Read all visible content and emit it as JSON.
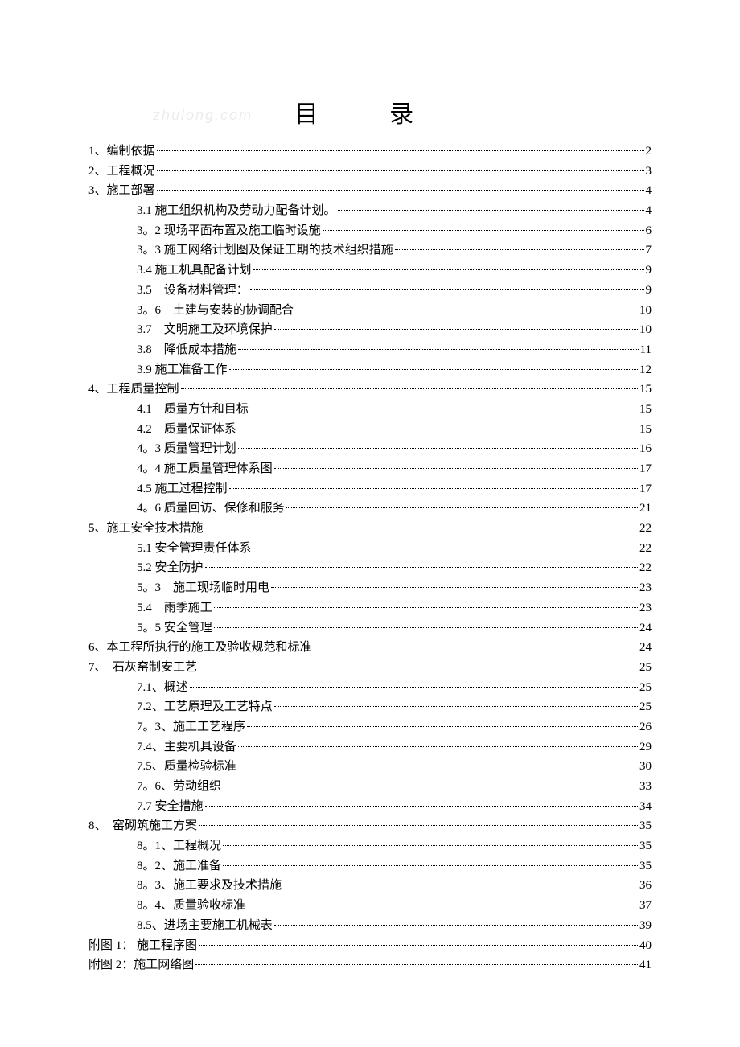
{
  "title": "目   录",
  "watermark": "zhulong.com",
  "toc": [
    {
      "label": "1、编制依据",
      "page": "2",
      "indent": false
    },
    {
      "label": "2、工程概况",
      "page": "3",
      "indent": false
    },
    {
      "label": "3、施工部署",
      "page": "4",
      "indent": false
    },
    {
      "label": "3.1  施工组织机构及劳动力配备计划。",
      "page": "4",
      "indent": true
    },
    {
      "label": "3。2  现场平面布置及施工临时设施",
      "page": "6",
      "indent": true
    },
    {
      "label": "3。3  施工网络计划图及保证工期的技术组织措施",
      "page": "7",
      "indent": true
    },
    {
      "label": "3.4 施工机具配备计划",
      "page": "9",
      "indent": true
    },
    {
      "label": "3.5　设备材料管理：",
      "page": "9",
      "indent": true
    },
    {
      "label": "3。6　土建与安装的协调配合",
      "page": "10",
      "indent": true
    },
    {
      "label": "3.7　文明施工及环境保护",
      "page": "10",
      "indent": true
    },
    {
      "label": "3.8　降低成本措施",
      "page": "11",
      "indent": true
    },
    {
      "label": "3.9  施工准备工作",
      "page": "12",
      "indent": true
    },
    {
      "label": "4、工程质量控制",
      "page": "15",
      "indent": false
    },
    {
      "label": "4.1　质量方针和目标",
      "page": "15",
      "indent": true
    },
    {
      "label": "4.2　质量保证体系",
      "page": "15",
      "indent": true
    },
    {
      "label": "4。3 质量管理计划",
      "page": "16",
      "indent": true
    },
    {
      "label": "4。4 施工质量管理体系图",
      "page": "17",
      "indent": true
    },
    {
      "label": "4.5 施工过程控制",
      "page": "17",
      "indent": true
    },
    {
      "label": "4。6  质量回访、保修和服务",
      "page": "21",
      "indent": true
    },
    {
      "label": "5、施工安全技术措施",
      "page": "22",
      "indent": false
    },
    {
      "label": "5.1  安全管理责任体系",
      "page": "22",
      "indent": true
    },
    {
      "label": "5.2 安全防护",
      "page": "22",
      "indent": true
    },
    {
      "label": "5。3　施工现场临时用电",
      "page": "23",
      "indent": true
    },
    {
      "label": "5.4　雨季施工",
      "page": "23",
      "indent": true
    },
    {
      "label": "5。5 安全管理",
      "page": "24",
      "indent": true
    },
    {
      "label": "6、本工程所执行的施工及验收规范和标准",
      "page": "24",
      "indent": false
    },
    {
      "label": "7、　石灰窑制安工艺",
      "page": "25",
      "indent": false
    },
    {
      "label": "7.1、概述",
      "page": "25",
      "indent": true
    },
    {
      "label": "7.2、工艺原理及工艺特点",
      "page": "25",
      "indent": true
    },
    {
      "label": "7。3、施工工艺程序",
      "page": "26",
      "indent": true
    },
    {
      "label": "7.4、主要机具设备",
      "page": "29",
      "indent": true
    },
    {
      "label": "7.5、质量检验标准",
      "page": "30",
      "indent": true
    },
    {
      "label": "7。6、劳动组织",
      "page": "33",
      "indent": true
    },
    {
      "label": "7.7 安全措施",
      "page": "34",
      "indent": true
    },
    {
      "label": "8、　窑砌筑施工方案",
      "page": "35",
      "indent": false
    },
    {
      "label": "8。1、工程概况",
      "page": "35",
      "indent": true
    },
    {
      "label": "8。2、施工准备",
      "page": "35",
      "indent": true
    },
    {
      "label": "8。3、施工要求及技术措施",
      "page": "36",
      "indent": true
    },
    {
      "label": "8。4、质量验收标准",
      "page": "37",
      "indent": true
    },
    {
      "label": "8.5、进场主要施工机械表",
      "page": "39",
      "indent": true
    },
    {
      "label": "附图 1： 施工程序图 ",
      "page": "40",
      "indent": false
    },
    {
      "label": "附图 2：施工网络图 ",
      "page": "41",
      "indent": false
    }
  ]
}
